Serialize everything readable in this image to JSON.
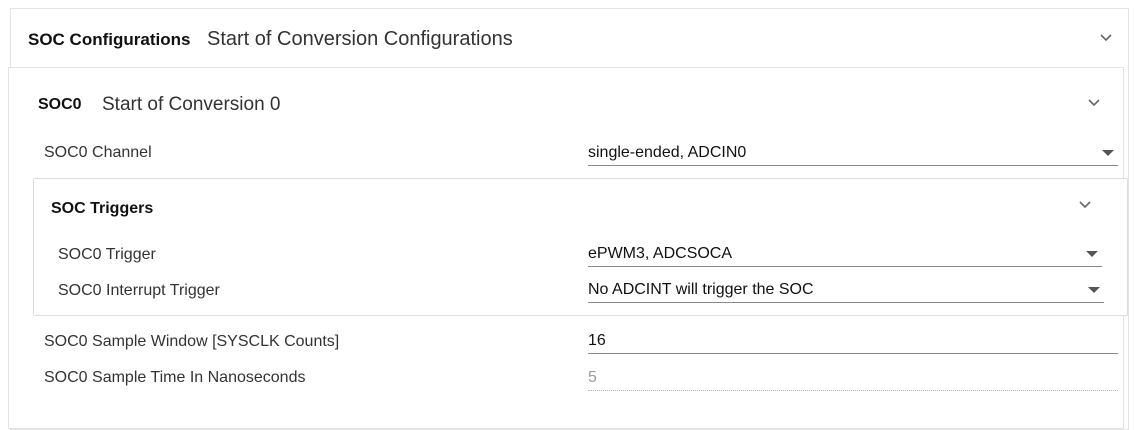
{
  "soc_configurations": {
    "title": "SOC Configurations",
    "description": "Start of Conversion Configurations",
    "expand_icon": "chevron-down-icon"
  },
  "soc0": {
    "title": "SOC0",
    "description": "Start of Conversion 0",
    "expand_icon": "chevron-down-icon",
    "channel": {
      "label": "SOC0 Channel",
      "value": "single-ended, ADCIN0"
    },
    "triggers": {
      "title": "SOC Triggers",
      "expand_icon": "chevron-down-icon",
      "trigger": {
        "label": "SOC0 Trigger",
        "value": "ePWM3, ADCSOCA"
      },
      "interrupt_trigger": {
        "label": "SOC0 Interrupt Trigger",
        "value": "No ADCINT will trigger the SOC"
      }
    },
    "sample_window": {
      "label": "SOC0 Sample Window [SYSCLK Counts]",
      "value": "16"
    },
    "sample_time": {
      "label": "SOC0 Sample Time In Nanoseconds",
      "value": "5"
    }
  }
}
